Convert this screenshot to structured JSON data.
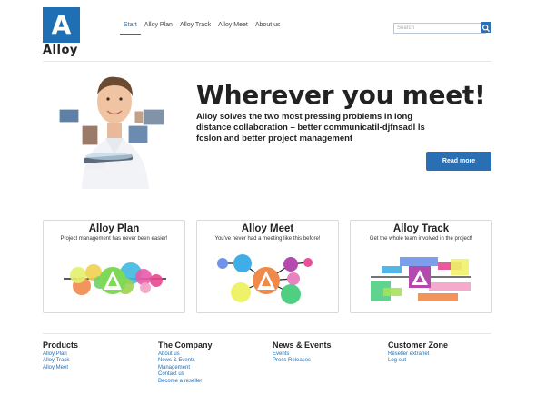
{
  "brand": {
    "logo_letter": "A",
    "logo_text": "Alloy",
    "accent": "#1f6fb5"
  },
  "nav": {
    "items": [
      "Start",
      "Alloy Plan",
      "Alloy Track",
      "Alloy Meet",
      "About us"
    ],
    "active": "Start"
  },
  "search": {
    "placeholder": "Search"
  },
  "hero": {
    "title": "Wherever you meet!",
    "text": "Alloy solves the two most pressing problems in long distance collaboration – better communicatil-djfnsadl ls fcslon and better project management",
    "button": "Read more"
  },
  "cards": [
    {
      "title": "Alloy Plan",
      "subtitle": "Project management has never been easier!"
    },
    {
      "title": "Alloy Meet",
      "subtitle": "You've never had a meeting like this before!"
    },
    {
      "title": "Alloy Track",
      "subtitle": "Get the whole team involved in the project!"
    }
  ],
  "footer": [
    {
      "heading": "Products",
      "links": [
        "Alloy Plan",
        "Alloy Track",
        "Alloy Meet"
      ]
    },
    {
      "heading": "The Company",
      "links": [
        "About us",
        "News & Events",
        "Management",
        "Contact us",
        "Become a reseller"
      ]
    },
    {
      "heading": "News & Events",
      "links": [
        "Events",
        "Press Releases"
      ]
    },
    {
      "heading": "Customer Zone",
      "links": [
        "Reseller extranet",
        "Log out"
      ]
    }
  ]
}
